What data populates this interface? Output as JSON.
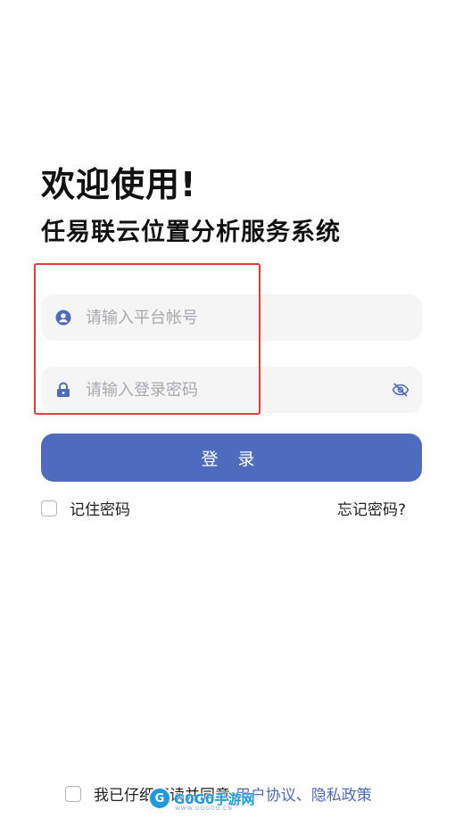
{
  "header": {
    "greeting": "欢迎使用!",
    "system_name": "任易联云位置分析服务系统"
  },
  "form": {
    "account_placeholder": "请输入平台帐号",
    "password_placeholder": "请输入登录密码",
    "account_icon": "user-icon",
    "password_icon": "lock-icon",
    "toggle_icon": "eye-off-icon",
    "login_label": "登 录",
    "remember_label": "记住密码",
    "forgot_label": "忘记密码?"
  },
  "agreement": {
    "prefix": "我已仔细阅读并同意:",
    "user_agreement": "用户协议",
    "separator": "、",
    "privacy_policy": "隐私政策"
  },
  "watermark": {
    "logo_letter": "G",
    "text": "G0G0手游网",
    "url": "WWW.GOGOO.CN"
  },
  "colors": {
    "accent": "#4f6bbd",
    "field_bg": "#f5f5f6",
    "highlight": "#e43b3b"
  }
}
